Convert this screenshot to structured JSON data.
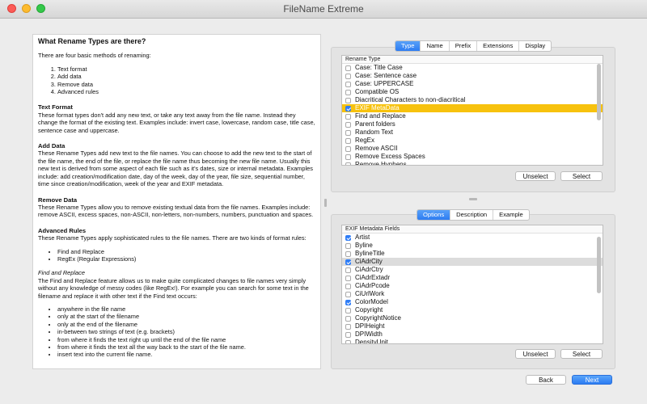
{
  "window": {
    "title": "FileName Extreme"
  },
  "doc": {
    "heading": "What Rename Types are there?",
    "intro": "There are four basic methods of renaming:",
    "methods": [
      "Text format",
      "Add data",
      "Remove data",
      "Advanced rules"
    ],
    "sections": [
      {
        "title": "Text Format",
        "body": "These format types don't add any new text, or take any text away from the file name. Instead they change the format of the existing text. Examples include: invert case, lowercase, random case, title case, sentence case and uppercase."
      },
      {
        "title": "Add Data",
        "body": "These Rename Types add new text to the file names. You can choose to add the new text to the start of the file name, the end of the file, or replace the file name thus becoming the new file name. Usually this new text is derived from some aspect of each file such as it's dates, size or internal metadata. Examples include: add creation/modification date, day of the week, day of the year, file size, sequential number, time since creation/modification, week of the year and EXIF metadata."
      },
      {
        "title": "Remove Data",
        "body": "These Rename Types allow you to remove existing textual data from the file names. Examples include: remove ASCII, excess spaces, non-ASCII, non-letters, non-numbers, numbers, punctuation and spaces."
      },
      {
        "title": "Advanced Rules",
        "body": "These Rename Types apply sophisticated rules to the file names. There are two kinds of format rules:"
      }
    ],
    "advanced_items": [
      "Find and Replace",
      "RegEx (Regular Expressions)"
    ],
    "find_title": "Find and Replace",
    "find_body": "The Find and Replace feature allows us to make quite complicated changes to file names very simply without any knowledge of messy codes (like RegEx!). For example you can search for some text in the filename and replace it with other text if the Find text occurs:",
    "find_items": [
      "anywhere in the file name",
      "only at the start of the filename",
      "only at the end of the filename",
      "in-between two strings of text (e.g. brackets)",
      "from where it finds the text right up until the end of the file name",
      "from where it finds the text all the way back to the start of the file name.",
      "insert text into the current file name."
    ]
  },
  "top_tabs": [
    "Type",
    "Name",
    "Prefix",
    "Extensions",
    "Display"
  ],
  "top_tabs_selected": "Type",
  "rename_list": {
    "header": "Rename Type",
    "items": [
      {
        "label": "Case: Title Case",
        "checked": false
      },
      {
        "label": "Case: Sentence case",
        "checked": false
      },
      {
        "label": "Case: UPPERCASE",
        "checked": false
      },
      {
        "label": "Compatible OS",
        "checked": false
      },
      {
        "label": "Diacritical Characters to non-diacritical",
        "checked": false
      },
      {
        "label": "EXIF MetaData",
        "checked": true,
        "highlight": "gold"
      },
      {
        "label": "Find and Replace",
        "checked": false
      },
      {
        "label": "Parent folders",
        "checked": false
      },
      {
        "label": "Random Text",
        "checked": false
      },
      {
        "label": "RegEx",
        "checked": false
      },
      {
        "label": "Remove ASCII",
        "checked": false
      },
      {
        "label": "Remove Excess Spaces",
        "checked": false
      },
      {
        "label": "Remove Hyphens",
        "checked": false
      }
    ]
  },
  "top_buttons": {
    "unselect": "Unselect",
    "select": "Select"
  },
  "bottom_tabs": [
    "Options",
    "Description",
    "Example"
  ],
  "bottom_tabs_selected": "Options",
  "exif_list": {
    "header": "EXIF Metadata Fields",
    "items": [
      {
        "label": "Artist",
        "checked": true
      },
      {
        "label": "Byline",
        "checked": false
      },
      {
        "label": "BylineTitle",
        "checked": false
      },
      {
        "label": "CiAdrCity",
        "checked": true,
        "highlight": "grey"
      },
      {
        "label": "CiAdrCtry",
        "checked": false
      },
      {
        "label": "CiAdrExtadr",
        "checked": false
      },
      {
        "label": "CiAdrPcode",
        "checked": false
      },
      {
        "label": "CiUrlWork",
        "checked": false
      },
      {
        "label": "ColorModel",
        "checked": true
      },
      {
        "label": "Copyright",
        "checked": false
      },
      {
        "label": "CopyrightNotice",
        "checked": false
      },
      {
        "label": "DPIHeight",
        "checked": false
      },
      {
        "label": "DPIWidth",
        "checked": false
      },
      {
        "label": "DensityUnit",
        "checked": false
      }
    ]
  },
  "bottom_buttons": {
    "unselect": "Unselect",
    "select": "Select"
  },
  "nav": {
    "back": "Back",
    "next": "Next"
  }
}
